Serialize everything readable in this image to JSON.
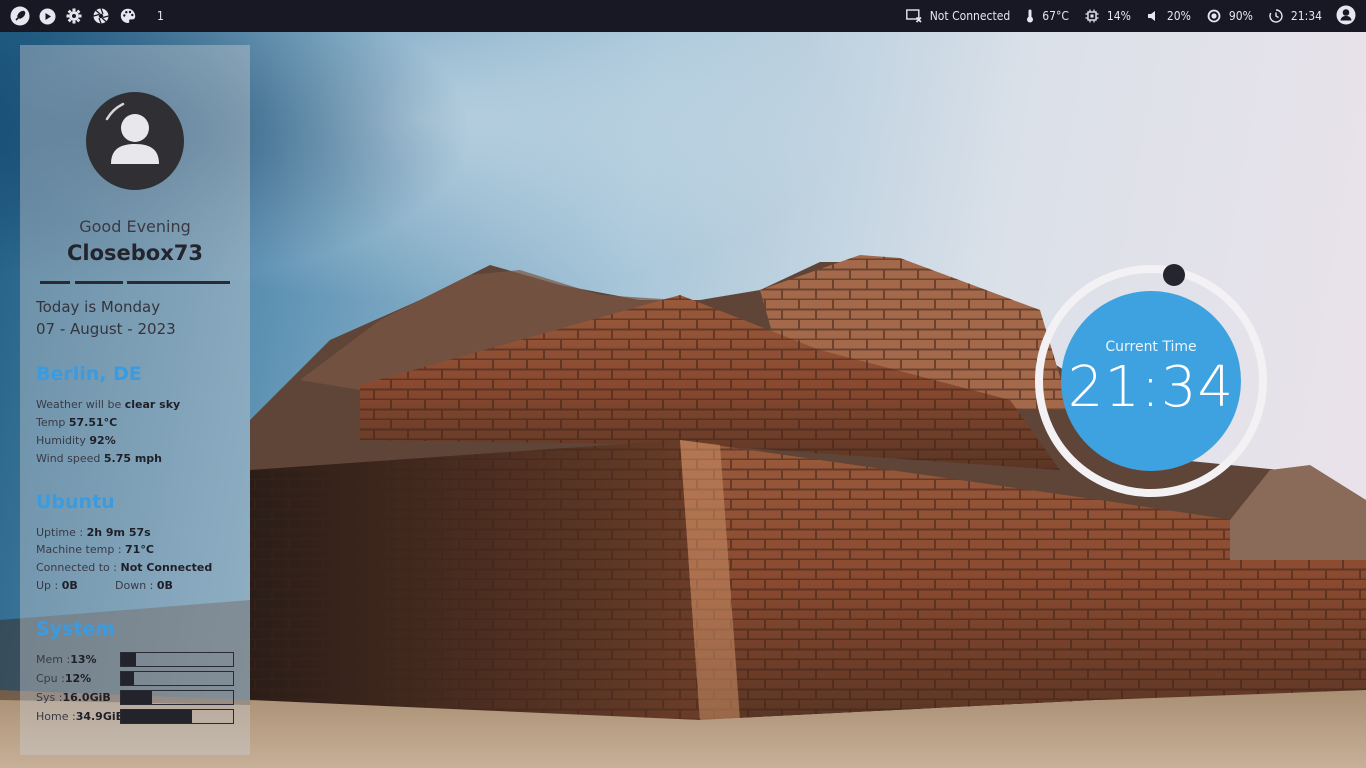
{
  "topbar": {
    "workspace": "1",
    "left_icons": [
      "rocket-icon",
      "play-icon",
      "gear-icon",
      "aperture-icon",
      "palette-icon"
    ],
    "network": "Not Connected",
    "temperature": "67°C",
    "cpu": "14%",
    "volume": "20%",
    "brightness": "90%",
    "clock": "21:34"
  },
  "sidebar": {
    "greeting": "Good Evening",
    "username": "Closebox73",
    "today": "Today is Monday",
    "date": "07 - August - 2023",
    "weather": {
      "title": "Berlin, DE",
      "line1_label": "Weather will be",
      "line1_value": "clear sky",
      "temp_label": "Temp",
      "temp_value": "57.51°C",
      "humidity_label": "Humidity",
      "humidity_value": "92%",
      "wind_label": "Wind speed",
      "wind_value": "5.75 mph"
    },
    "ubuntu": {
      "title": "Ubuntu",
      "uptime_label": "Uptime :",
      "uptime_value": "2h 9m 57s",
      "machine_temp_label": "Machine temp :",
      "machine_temp_value": "71°C",
      "connected_label": "Connected to :",
      "connected_value": "Not Connected",
      "up_label": "Up :",
      "up_value": "0B",
      "down_label": "Down :",
      "down_value": "0B"
    },
    "system": {
      "title": "System",
      "bars": [
        {
          "label": "Mem :",
          "value": "13%",
          "fraction": 0.13
        },
        {
          "label": "Cpu :",
          "value": "12%",
          "fraction": 0.12
        },
        {
          "label": "Sys :",
          "value": "16.0GiB",
          "fraction": 0.28
        },
        {
          "label": "Home :",
          "value": "34.9GiB",
          "fraction": 0.63
        }
      ]
    }
  },
  "clock_widget": {
    "caption": "Current Time",
    "time": "21:34"
  },
  "colors": {
    "accent": "#3ea1e0",
    "topbar_bg": "#181825",
    "panel_text": "#2c2c33"
  }
}
